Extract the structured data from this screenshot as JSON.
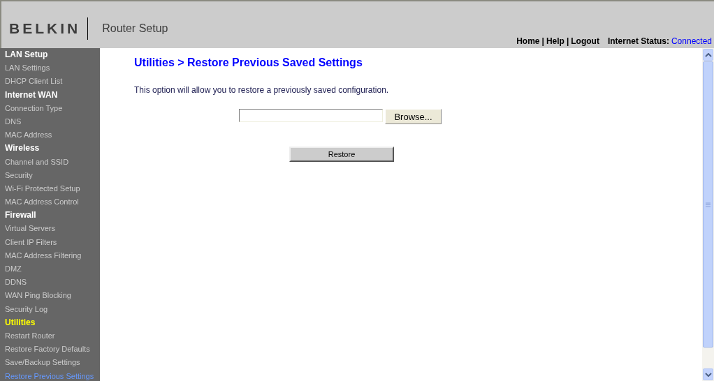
{
  "header": {
    "logo": "BELKIN",
    "title": "Router Setup",
    "links": [
      "Home",
      "Help",
      "Logout"
    ],
    "link_separator": "|",
    "status_label": "Internet Status:",
    "status_value": "Connected"
  },
  "sidebar": [
    {
      "label": "LAN Setup",
      "active": false,
      "items": [
        {
          "label": "LAN Settings",
          "selected": false
        },
        {
          "label": "DHCP Client List",
          "selected": false
        }
      ]
    },
    {
      "label": "Internet WAN",
      "active": false,
      "items": [
        {
          "label": "Connection Type",
          "selected": false
        },
        {
          "label": "DNS",
          "selected": false
        },
        {
          "label": "MAC Address",
          "selected": false
        }
      ]
    },
    {
      "label": "Wireless",
      "active": false,
      "items": [
        {
          "label": "Channel and SSID",
          "selected": false
        },
        {
          "label": "Security",
          "selected": false
        },
        {
          "label": "Wi-Fi Protected Setup",
          "selected": false
        },
        {
          "label": "MAC Address Control",
          "selected": false
        }
      ]
    },
    {
      "label": "Firewall",
      "active": false,
      "items": [
        {
          "label": "Virtual Servers",
          "selected": false
        },
        {
          "label": "Client IP Filters",
          "selected": false
        },
        {
          "label": "MAC Address Filtering",
          "selected": false
        },
        {
          "label": "DMZ",
          "selected": false
        },
        {
          "label": "DDNS",
          "selected": false
        },
        {
          "label": "WAN Ping Blocking",
          "selected": false
        },
        {
          "label": "Security Log",
          "selected": false
        }
      ]
    },
    {
      "label": "Utilities",
      "active": true,
      "items": [
        {
          "label": "Restart Router",
          "selected": false
        },
        {
          "label": "Restore Factory Defaults",
          "selected": false
        },
        {
          "label": "Save/Backup Settings",
          "selected": false
        },
        {
          "label": "Restore Previous Settings",
          "selected": true
        }
      ]
    }
  ],
  "page": {
    "title": "Utilities > Restore Previous Saved Settings",
    "description": "This option will allow you to restore a previously saved configuration.",
    "browse_button": "Browse...",
    "restore_button": "Restore"
  }
}
